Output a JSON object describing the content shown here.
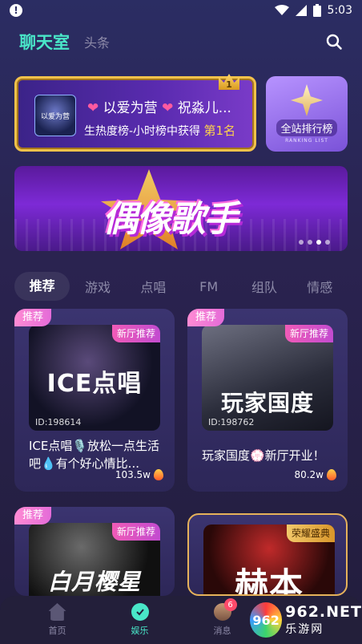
{
  "status_bar": {
    "time": "5:03"
  },
  "top_nav": {
    "main_tab": "聊天室",
    "sub_tab": "头条"
  },
  "rank_card": {
    "heart1": "❤",
    "heart2": "❤",
    "name_part1": " 以爱为营 ",
    "name_part2": " 祝淼儿...",
    "desc_prefix": "生热度榜-小时榜中获得 ",
    "desc_rank": "第1名",
    "crown_rank": "1",
    "thumb_text": "以爱为营"
  },
  "all_rank": {
    "label": "全站排行榜",
    "sub": "RANKING LIST"
  },
  "banner": {
    "title": "偶像歌手",
    "slide_count": 4,
    "active_slide": 2
  },
  "categories": [
    "推荐",
    "游戏",
    "点唱",
    "FM",
    "组队",
    "情感"
  ],
  "rooms": [
    {
      "tag": "推荐",
      "badge": "新厅推荐",
      "cover_title": "ICE点唱",
      "room_id": "ID:198614",
      "desc": "ICE点唱🎙️放松一点生活吧💧有个好心情比...",
      "heat": "103.5w"
    },
    {
      "tag": "推荐",
      "badge": "新厅推荐",
      "cover_title": "玩家国度",
      "room_id": "ID:198762",
      "desc": "玩家国度💮新厅开业！",
      "heat": "80.2w"
    },
    {
      "tag": "推荐",
      "badge": "新厅推荐",
      "cover_title": "白月樱星",
      "room_id": "",
      "desc": "",
      "heat": ""
    },
    {
      "tag": "",
      "badge": "荣耀盛典",
      "cover_title": "赫本",
      "room_id": "",
      "desc": "",
      "heat": ""
    }
  ],
  "bottom_nav": {
    "items": [
      {
        "label": "首页"
      },
      {
        "label": "娱乐"
      },
      {
        "label": "消息"
      }
    ],
    "message_badge": "6"
  },
  "watermark": {
    "logo": "962",
    "top": "962.NET",
    "bottom": "乐游网"
  }
}
